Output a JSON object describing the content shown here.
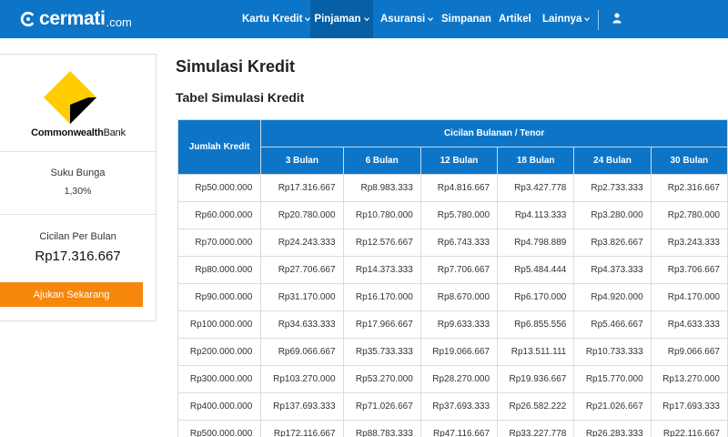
{
  "header": {
    "logo_text": "cermati",
    "logo_domain": ".com",
    "nav": [
      {
        "label": "Kartu Kredit",
        "dropdown": true,
        "active": false
      },
      {
        "label": "Pinjaman",
        "dropdown": true,
        "active": true
      },
      {
        "label": "Asuransi",
        "dropdown": true,
        "active": false
      },
      {
        "label": "Simpanan",
        "dropdown": false,
        "active": false
      },
      {
        "label": "Artikel",
        "dropdown": false,
        "active": false
      },
      {
        "label": "Lainnya",
        "dropdown": true,
        "active": false
      }
    ],
    "user_icon": "user-icon"
  },
  "sidebar": {
    "bank_name_bold": "Commonwealth",
    "bank_name_rest": "Bank",
    "rate_label": "Suku Bunga",
    "rate_value": "1,30%",
    "payment_label": "Cicilan Per Bulan",
    "payment_value": "Rp17.316.667",
    "apply_label": "Ajukan Sekarang"
  },
  "main": {
    "title": "Simulasi Kredit",
    "table_title": "Tabel Simulasi Kredit",
    "table": {
      "amount_header": "Jumlah Kredit",
      "group_header": "Cicilan Bulanan / Tenor",
      "tenor_headers": [
        "3 Bulan",
        "6 Bulan",
        "12 Bulan",
        "18 Bulan",
        "24 Bulan",
        "30 Bulan"
      ],
      "rows": [
        {
          "amount": "Rp50.000.000",
          "values": [
            "Rp17.316.667",
            "Rp8.983.333",
            "Rp4.816.667",
            "Rp3.427.778",
            "Rp2.733.333",
            "Rp2.316.667"
          ]
        },
        {
          "amount": "Rp60.000.000",
          "values": [
            "Rp20.780.000",
            "Rp10.780.000",
            "Rp5.780.000",
            "Rp4.113.333",
            "Rp3.280.000",
            "Rp2.780.000"
          ]
        },
        {
          "amount": "Rp70.000.000",
          "values": [
            "Rp24.243.333",
            "Rp12.576.667",
            "Rp6.743.333",
            "Rp4.798.889",
            "Rp3.826.667",
            "Rp3.243.333"
          ]
        },
        {
          "amount": "Rp80.000.000",
          "values": [
            "Rp27.706.667",
            "Rp14.373.333",
            "Rp7.706.667",
            "Rp5.484.444",
            "Rp4.373.333",
            "Rp3.706.667"
          ]
        },
        {
          "amount": "Rp90.000.000",
          "values": [
            "Rp31.170.000",
            "Rp16.170.000",
            "Rp8.670.000",
            "Rp6.170.000",
            "Rp4.920.000",
            "Rp4.170.000"
          ]
        },
        {
          "amount": "Rp100.000.000",
          "values": [
            "Rp34.633.333",
            "Rp17.966.667",
            "Rp9.633.333",
            "Rp6.855.556",
            "Rp5.466.667",
            "Rp4.633.333"
          ]
        },
        {
          "amount": "Rp200.000.000",
          "values": [
            "Rp69.066.667",
            "Rp35.733.333",
            "Rp19.066.667",
            "Rp13.511.111",
            "Rp10.733.333",
            "Rp9.066.667"
          ]
        },
        {
          "amount": "Rp300.000.000",
          "values": [
            "Rp103.270.000",
            "Rp53.270.000",
            "Rp28.270.000",
            "Rp19.936.667",
            "Rp15.770.000",
            "Rp13.270.000"
          ]
        },
        {
          "amount": "Rp400.000.000",
          "values": [
            "Rp137.693.333",
            "Rp71.026.667",
            "Rp37.693.333",
            "Rp26.582.222",
            "Rp21.026.667",
            "Rp17.693.333"
          ]
        },
        {
          "amount": "Rp500.000.000",
          "values": [
            "Rp172.116.667",
            "Rp88.783.333",
            "Rp47.116.667",
            "Rp33.227.778",
            "Rp26.283.333",
            "Rp22.116.667"
          ]
        }
      ]
    }
  },
  "colors": {
    "header_bg": "#0d75c7",
    "nav_active_bg": "#075fa6",
    "apply_button": "#f5870d",
    "bank_logo_yellow": "#ffcc00"
  }
}
